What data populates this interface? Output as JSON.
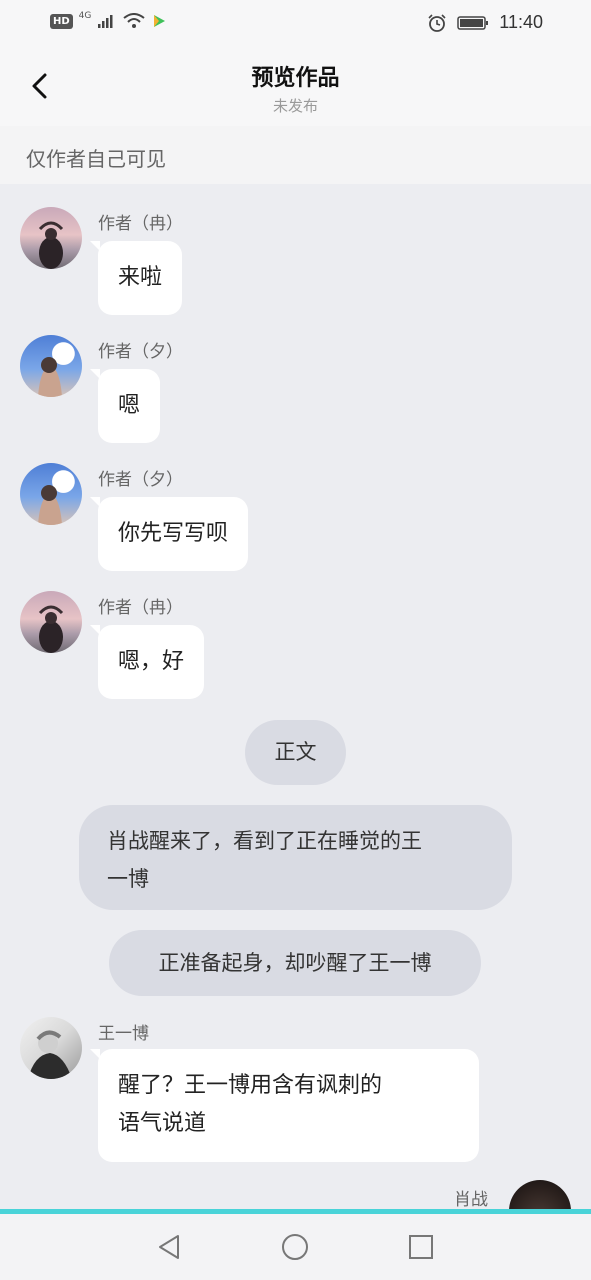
{
  "status_bar": {
    "hd": "HD",
    "network": "4G",
    "time": "11:40",
    "icons": [
      "signal-icon",
      "wifi-icon",
      "video-app-icon",
      "alarm-icon",
      "battery-icon"
    ]
  },
  "header": {
    "title": "预览作品",
    "subtitle": "未发布"
  },
  "notice": "仅作者自己可见",
  "messages": [
    {
      "name": "作者（冉）",
      "text": "来啦"
    },
    {
      "name": "作者（夕）",
      "text": "嗯"
    },
    {
      "name": "作者（夕）",
      "text": "你先写写呗"
    },
    {
      "name": "作者（冉）",
      "text": "嗯，好"
    }
  ],
  "section_label": "正文",
  "narrations": [
    {
      "line1": "肖战醒来了，看到了正在睡觉的王",
      "line2": "一博"
    },
    {
      "line1": "正准备起身，却吵醒了王一博"
    }
  ],
  "wyb_message": {
    "name": "王一博",
    "line1": "醒了？王一博用含有讽刺的",
    "line2": "语气说道"
  },
  "xz_name": "肖战",
  "colors": {
    "accent": "#49d3d8",
    "bubble": "#ffffff",
    "narration": "#d9dbe3",
    "background": "#ecedf1"
  }
}
